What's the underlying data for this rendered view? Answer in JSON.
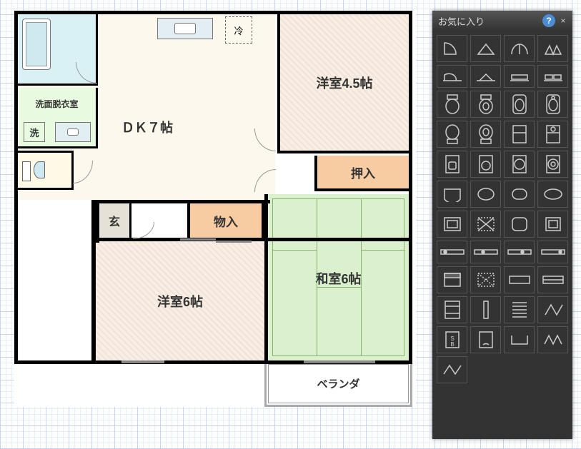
{
  "floorplan": {
    "rooms": {
      "dk": "ＤＫ７帖",
      "yoshitsu45": "洋室4.5帖",
      "yoshitsu6": "洋室6帖",
      "washitsu": "和室6帖",
      "senmen": "洗面脱衣室",
      "genkan": "玄",
      "monoire": "物入",
      "oshiire": "押入",
      "veranda": "ベランダ"
    },
    "fixtures": {
      "sen": "洗",
      "rei": "冷"
    }
  },
  "panel": {
    "title": "お気に入り",
    "help": "?",
    "close": "×",
    "shapes": [
      "quarter-arc",
      "triangle",
      "double-door",
      "double-triangle",
      "flat-quarter",
      "flat-triangle",
      "flat-rect",
      "flat-split",
      "toilet-a",
      "toilet-b",
      "toilet-c",
      "toilet-d",
      "toilet-e",
      "toilet-f",
      "rect-split-a",
      "rect-split-b",
      "sink-a",
      "sink-b",
      "washer-a",
      "washer-b",
      "tub-a",
      "tub-b",
      "tub-round",
      "oval",
      "tray",
      "cross",
      "square-round",
      "square-thin",
      "bar-a",
      "bar-b",
      "bar-c",
      "bar-d",
      "box-a",
      "box-hatched",
      "flat-a",
      "flat-b",
      "panel-a",
      "pipe",
      "stair-a",
      "zigzag",
      "sb",
      "gauge",
      "open-a",
      "zigzag2",
      "zigzag3"
    ]
  }
}
